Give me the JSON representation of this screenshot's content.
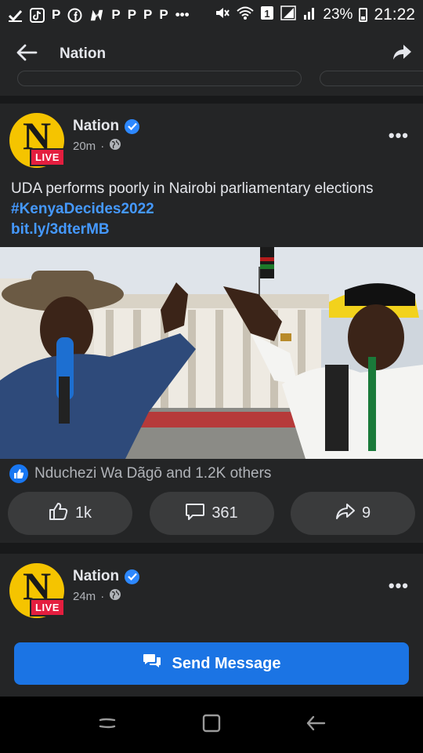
{
  "status_bar": {
    "icons": [
      "check-icon",
      "tiktok-icon",
      "p-icon",
      "facebook-icon",
      "n-icon",
      "p-icon",
      "p-icon",
      "p-icon",
      "p-icon",
      "more-notifications-icon",
      "mute-icon",
      "wifi-icon",
      "sim1-icon",
      "signal-icon",
      "signal2-icon",
      "battery-icon"
    ],
    "battery": "23%",
    "time": "21:22"
  },
  "header": {
    "title": "Nation"
  },
  "post1": {
    "page_name": "Nation",
    "avatar_letter": "N",
    "live_badge": "LIVE",
    "time": "20m",
    "dot": "·",
    "text": "UDA performs poorly in Nairobi parliamentary elections",
    "hashtag": "#KenyaDecides2022",
    "link": "bit.ly/3dterMB",
    "reactions_text": "Nduchezi Wa Dãgō and 1.2K others",
    "like_count": "1k",
    "comment_count": "361",
    "share_count": "9",
    "more": "•••"
  },
  "post2": {
    "page_name": "Nation",
    "avatar_letter": "N",
    "live_badge": "LIVE",
    "time": "24m",
    "dot": "·",
    "more": "•••"
  },
  "send_message": {
    "label": "Send Message"
  },
  "colors": {
    "accent": "#1b74e4",
    "link": "#4599ff",
    "live": "#e41e3f",
    "avatar": "#f5c400",
    "background": "#18191a",
    "card": "#242526"
  }
}
